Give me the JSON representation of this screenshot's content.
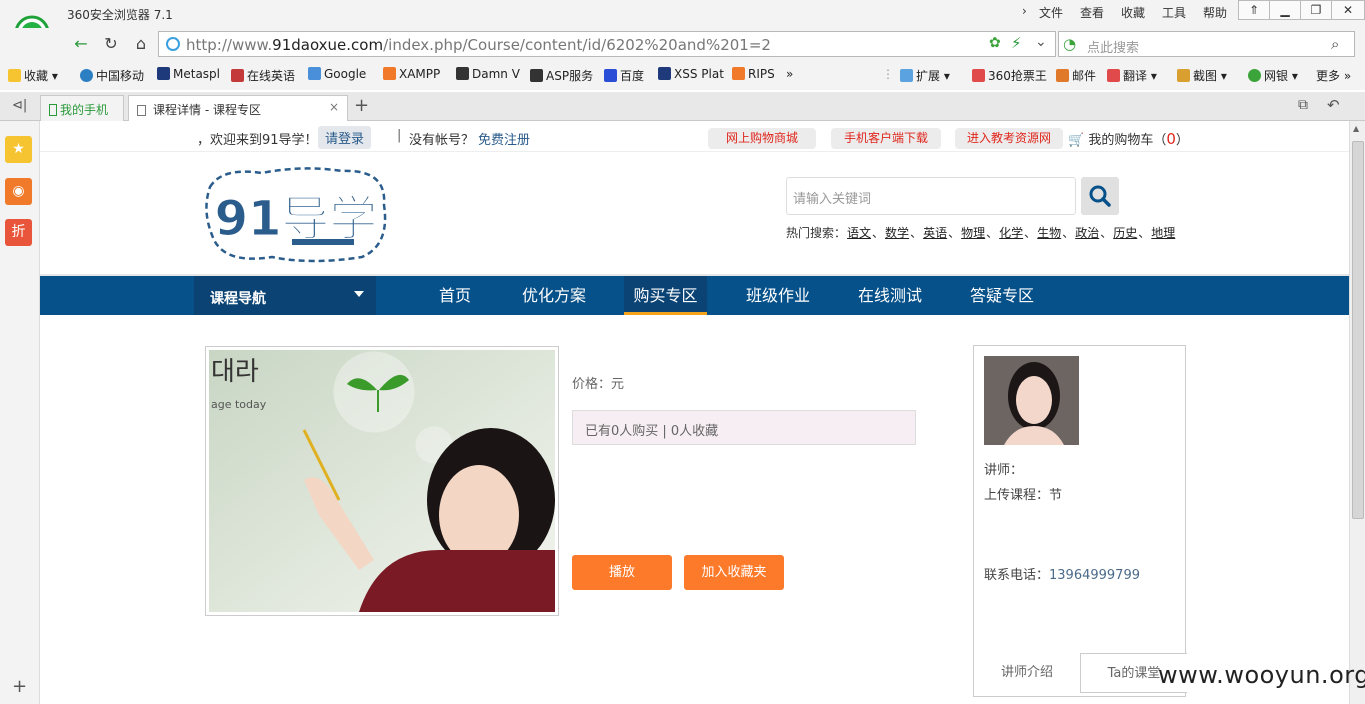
{
  "browser": {
    "title": "360安全浏览器 7.1",
    "menus": [
      "文件",
      "查看",
      "收藏",
      "工具",
      "帮助"
    ],
    "url_prefix": "http://www.",
    "url_domain": "91daoxue.com",
    "url_path": "/index.php/Course/content/id/6202%20and%201=2",
    "search_placeholder": "点此搜索",
    "bookmarks": [
      "收藏",
      "中国移动",
      "Metaspl",
      "在线英语",
      "Google",
      "XAMPP",
      "Damn V",
      "ASP服务",
      "百度",
      "XSS Plat",
      "RIPS"
    ],
    "toolbar_right": [
      "扩展",
      "360抢票王",
      "邮件",
      "翻译",
      "截图",
      "网银",
      "更多"
    ],
    "tabs": [
      {
        "label": "我的手机"
      },
      {
        "label": "课程详情 - 课程专区"
      }
    ],
    "sidebar_icons": [
      "star-icon",
      "weibo-icon",
      "discount-icon"
    ],
    "sidebar_discount": "折"
  },
  "site": {
    "welcome": "，欢迎来到91导学！",
    "login": "请登录",
    "separator": "|",
    "no_account": "没有帐号？",
    "register": "免费注册",
    "pills": [
      "网上购物商城",
      "手机客户端下载",
      "进入教考资源网"
    ],
    "cart_label": "我的购物车（",
    "cart_count": "0",
    "cart_close": "）",
    "search_placeholder": "请输入关键词",
    "hot_label": "热门搜索：",
    "hot_items": [
      "语文",
      "数学",
      "英语",
      "物理",
      "化学",
      "生物",
      "政治",
      "历史",
      "地理"
    ],
    "logo_text": "91导学"
  },
  "nav": {
    "category": "课程导航",
    "links": [
      "首页",
      "优化方案",
      "购买专区",
      "班级作业",
      "在线测试",
      "答疑专区"
    ],
    "active": "购买专区"
  },
  "course": {
    "price_label": "价格：元",
    "stats": "已有0人购买 | 0人收藏",
    "play": "播放",
    "favorite": "加入收藏夹",
    "image_text_1": "대라",
    "image_text_2": "age today"
  },
  "teacher": {
    "teacher_label": "讲师：",
    "uploads_label": "上传课程：节",
    "phone_label": "联系电话：",
    "phone": "13964999799",
    "tab_intro": "讲师介绍",
    "tab_courses": "Ta的课堂"
  },
  "watermark": "www.wooyun.org",
  "colors": {
    "nav": "#06518a",
    "accent": "#fd7a2b",
    "red": "#e0261c",
    "underline": "#f2a21b"
  }
}
